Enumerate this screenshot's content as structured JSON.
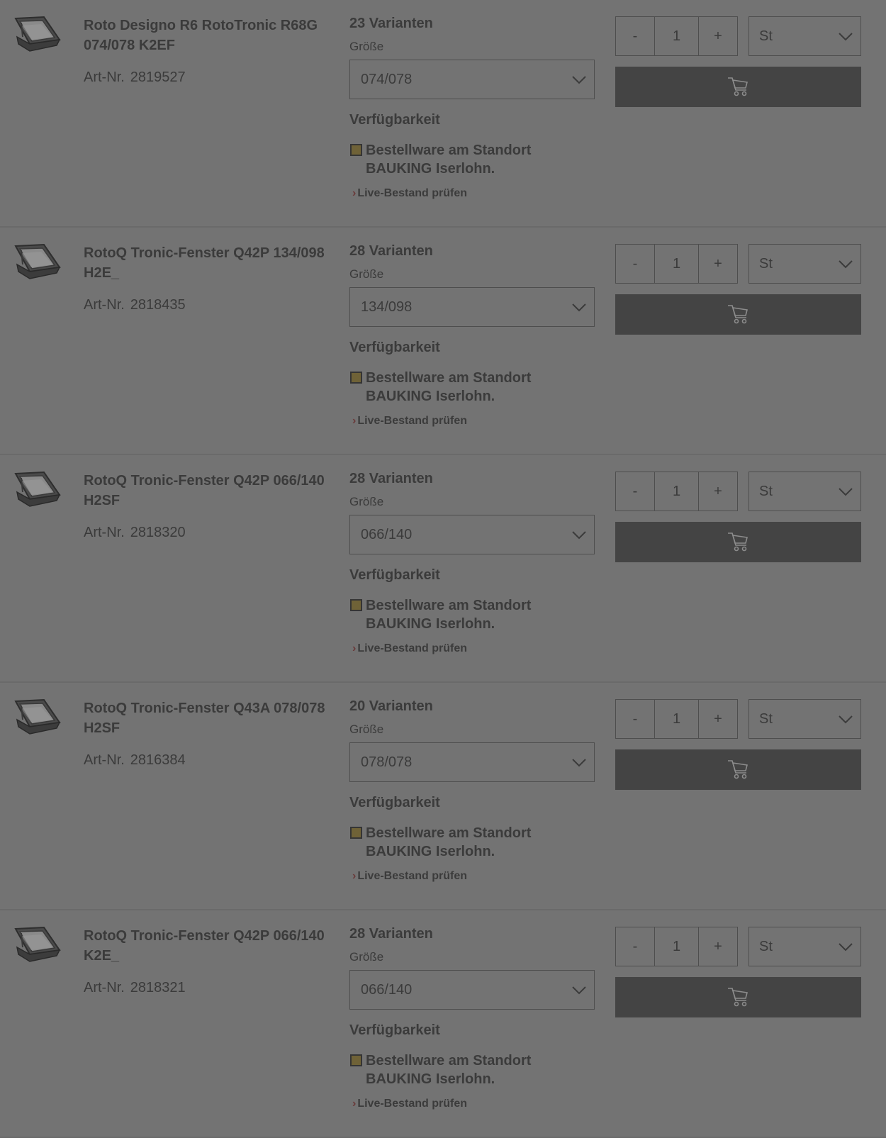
{
  "products": [
    {
      "title": "Roto Designo R6 RotoTronic R68G 074/078 K2EF",
      "art_label": "Art-Nr.",
      "art_nr": "2819527",
      "variants": "23 Varianten",
      "size_label": "Größe",
      "size_value": "074/078",
      "availability_label": "Verfügbarkeit",
      "status": "Bestellware am Standort BAUKING Iserlohn.",
      "live_link": "Live-Bestand prüfen",
      "qty_minus": "-",
      "qty": "1",
      "qty_plus": "+",
      "unit": "St"
    },
    {
      "title": "RotoQ Tronic-Fenster Q42P 134/098 H2E_",
      "art_label": "Art-Nr.",
      "art_nr": "2818435",
      "variants": "28 Varianten",
      "size_label": "Größe",
      "size_value": "134/098",
      "availability_label": "Verfügbarkeit",
      "status": "Bestellware am Standort BAUKING Iserlohn.",
      "live_link": "Live-Bestand prüfen",
      "qty_minus": "-",
      "qty": "1",
      "qty_plus": "+",
      "unit": "St"
    },
    {
      "title": "RotoQ Tronic-Fenster Q42P 066/140 H2SF",
      "art_label": "Art-Nr.",
      "art_nr": "2818320",
      "variants": "28 Varianten",
      "size_label": "Größe",
      "size_value": "066/140",
      "availability_label": "Verfügbarkeit",
      "status": "Bestellware am Standort BAUKING Iserlohn.",
      "live_link": "Live-Bestand prüfen",
      "qty_minus": "-",
      "qty": "1",
      "qty_plus": "+",
      "unit": "St"
    },
    {
      "title": "RotoQ Tronic-Fenster Q43A 078/078 H2SF",
      "art_label": "Art-Nr.",
      "art_nr": "2816384",
      "variants": "20 Varianten",
      "size_label": "Größe",
      "size_value": "078/078",
      "availability_label": "Verfügbarkeit",
      "status": "Bestellware am Standort BAUKING Iserlohn.",
      "live_link": "Live-Bestand prüfen",
      "qty_minus": "-",
      "qty": "1",
      "qty_plus": "+",
      "unit": "St"
    },
    {
      "title": "RotoQ Tronic-Fenster Q42P 066/140 K2E_",
      "art_label": "Art-Nr.",
      "art_nr": "2818321",
      "variants": "28 Varianten",
      "size_label": "Größe",
      "size_value": "066/140",
      "availability_label": "Verfügbarkeit",
      "status": "Bestellware am Standort BAUKING Iserlohn.",
      "live_link": "Live-Bestand prüfen",
      "qty_minus": "-",
      "qty": "1",
      "qty_plus": "+",
      "unit": "St"
    }
  ],
  "icons": {
    "product_thumbnail": "roof-window-icon",
    "size_dropdown": "chevron-down-icon",
    "unit_dropdown": "chevron-down-icon",
    "cart": "cart-icon"
  },
  "colors": {
    "background": "#737373",
    "text": "#3b3b3b",
    "border": "#4e4e4e",
    "cart_button": "#444444",
    "status_square": "#6f6237",
    "link_arrow": "#6a3a3a"
  }
}
